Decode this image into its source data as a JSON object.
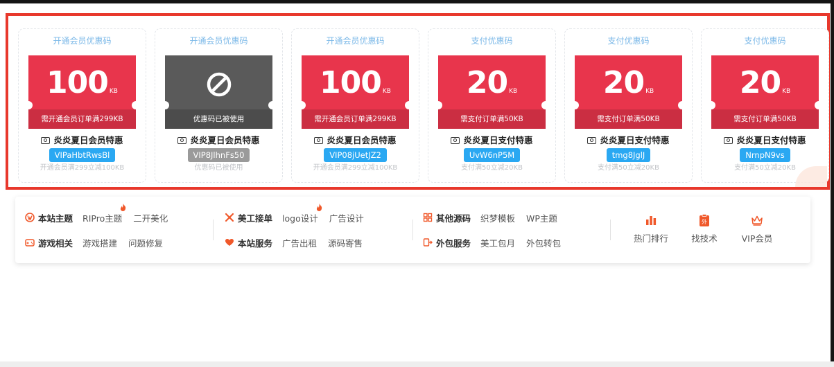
{
  "coupons": [
    {
      "type": "开通会员优惠码",
      "amount": "100",
      "unit": "KB",
      "condition": "需开通会员订单满299KB",
      "name": "炎炎夏日会员特惠",
      "code": "VIPaHbtRwsBl",
      "desc": "开通会员满299立减100KB",
      "used": false
    },
    {
      "type": "开通会员优惠码",
      "amount": "",
      "unit": "",
      "condition": "优惠码已被使用",
      "name": "炎炎夏日会员特惠",
      "code": "VIP8JlhnFs50",
      "desc": "优惠码已被使用",
      "used": true
    },
    {
      "type": "开通会员优惠码",
      "amount": "100",
      "unit": "KB",
      "condition": "需开通会员订单满299KB",
      "name": "炎炎夏日会员特惠",
      "code": "VIP08jUetJZ2",
      "desc": "开通会员满299立减100KB",
      "used": false
    },
    {
      "type": "支付优惠码",
      "amount": "20",
      "unit": "KB",
      "condition": "需支付订单满50KB",
      "name": "炎炎夏日支付特惠",
      "code": "UvW6nP5M",
      "desc": "支付满50立减20KB",
      "used": false
    },
    {
      "type": "支付优惠码",
      "amount": "20",
      "unit": "KB",
      "condition": "需支付订单满50KB",
      "name": "炎炎夏日支付特惠",
      "code": "tmg8JglJ",
      "desc": "支付满50立减20KB",
      "used": false
    },
    {
      "type": "支付优惠码",
      "amount": "20",
      "unit": "KB",
      "condition": "需支付订单满50KB",
      "name": "炎炎夏日支付特惠",
      "code": "NrnpN9vs",
      "desc": "支付满50立减20KB",
      "used": false
    }
  ],
  "nav": {
    "group1": {
      "row1": {
        "head": "本站主题",
        "icon": "wordpress-icon",
        "links": [
          "RIPro主题",
          "二开美化"
        ]
      },
      "row2": {
        "head": "游戏相关",
        "icon": "gamepad-icon",
        "links": [
          "游戏搭建",
          "问题修复"
        ]
      }
    },
    "group2": {
      "row1": {
        "head": "美工接单",
        "icon": "cross-tools-icon",
        "links": [
          "logo设计",
          "广告设计"
        ]
      },
      "row2": {
        "head": "本站服务",
        "icon": "heart-icon",
        "links": [
          "广告出租",
          "源码寄售"
        ]
      }
    },
    "group3": {
      "row1": {
        "head": "其他源码",
        "icon": "grid-icon",
        "links": [
          "织梦模板",
          "WP主题"
        ]
      },
      "row2": {
        "head": "外包服务",
        "icon": "outsource-icon",
        "links": [
          "美工包月",
          "外包转包"
        ]
      }
    },
    "quick": [
      {
        "label": "热门排行",
        "icon": "bar-chart-icon"
      },
      {
        "label": "找技术",
        "icon": "clipboard-icon"
      },
      {
        "label": "VIP会员",
        "icon": "crown-icon"
      }
    ]
  },
  "colors": {
    "frame": "#e8382c",
    "ticket": "#e8354c",
    "ticket_used": "#5a5a5a",
    "code_pill": "#2aa8f2",
    "nav_icon": "#f0582a"
  }
}
